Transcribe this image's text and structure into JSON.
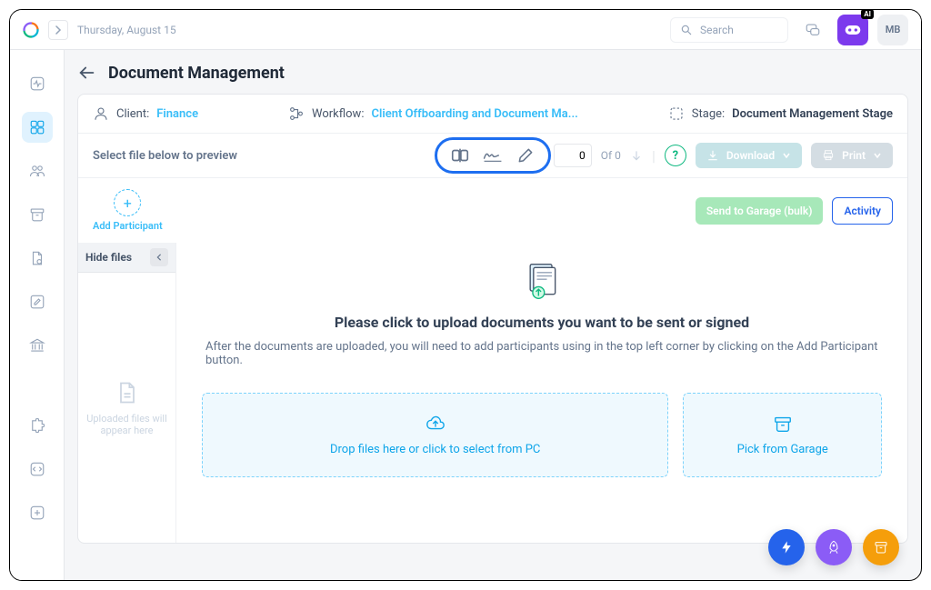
{
  "topbar": {
    "date": "Thursday, August 15",
    "search_placeholder": "Search",
    "ai_badge": "AI",
    "user_initials": "MB"
  },
  "page": {
    "title": "Document Management"
  },
  "info": {
    "client_label": "Client:",
    "client_value": "Finance",
    "workflow_label": "Workflow:",
    "workflow_value": "Client Offboarding and Document Ma...",
    "stage_label": "Stage:",
    "stage_value": "Document Management Stage"
  },
  "toolbar": {
    "select_text": "Select file below to preview",
    "page_value": "0",
    "of_text": "Of 0",
    "download": "Download",
    "print": "Print"
  },
  "actions": {
    "add_participant": "Add Participant",
    "send_garage": "Send to Garage (bulk)",
    "activity": "Activity"
  },
  "files": {
    "hide_label": "Hide files",
    "empty_text": "Uploaded files will appear here"
  },
  "upload": {
    "title": "Please click to upload documents you want to be sent or signed",
    "subtitle": "After the documents are uploaded, you will need to add participants using in the top left corner by clicking on the Add Participant button.",
    "drop_text": "Drop files here or click to select from PC",
    "pick_text": "Pick from Garage"
  }
}
